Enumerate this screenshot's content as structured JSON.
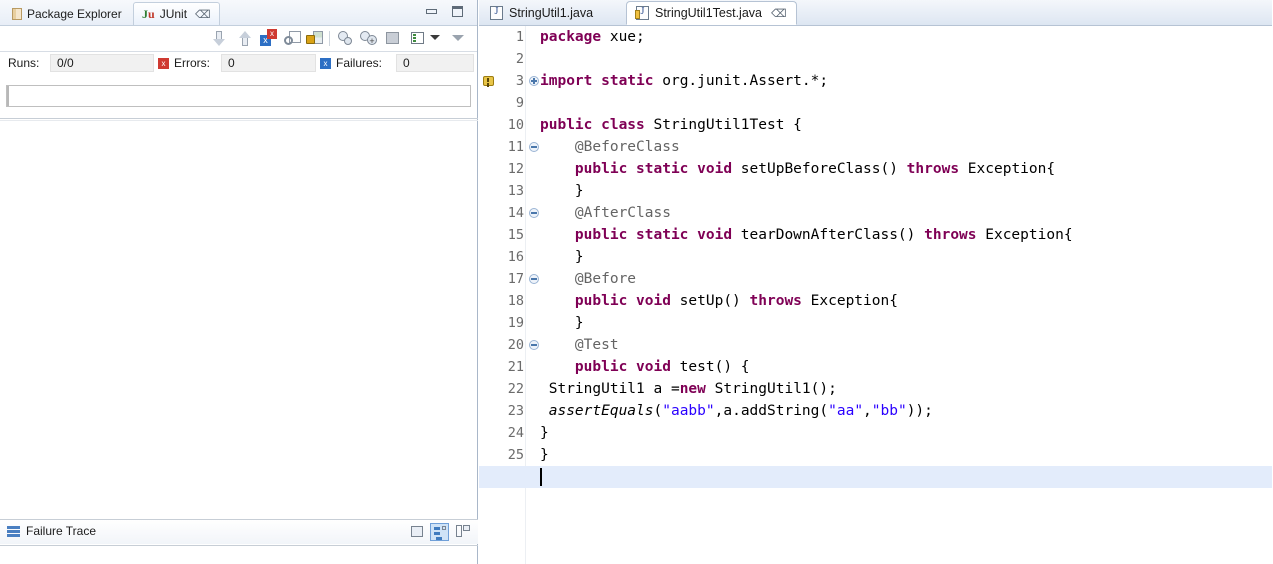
{
  "left_view": {
    "tabs": [
      {
        "label": "Package Explorer",
        "icon": "package-explorer-icon",
        "active": false,
        "closable": false
      },
      {
        "label": "JUnit",
        "icon": "junit-icon",
        "active": true,
        "closable": true
      }
    ],
    "window_controls": [
      {
        "name": "minimize",
        "icon": "minimize-icon"
      },
      {
        "name": "maximize",
        "icon": "maximize-icon"
      }
    ],
    "toolbar": [
      {
        "name": "next-failure-button",
        "icon": "arrow-down-icon"
      },
      {
        "name": "previous-failure-button",
        "icon": "arrow-up-icon"
      },
      {
        "name": "show-failures-only-button",
        "icon": "failures-filter-icon"
      },
      {
        "name": "rerun-test-button",
        "icon": "rerun-icon"
      },
      {
        "name": "scroll-lock-button",
        "icon": "lock-icon"
      },
      {
        "name": "rerun-last-test-button",
        "icon": "history-icon"
      },
      {
        "name": "rerun-failed-tests-button",
        "icon": "history-add-icon"
      },
      {
        "name": "show-console-button",
        "icon": "console-icon"
      },
      {
        "name": "test-run-history-button",
        "icon": "test-list-icon"
      },
      {
        "name": "test-run-history-dropdown",
        "icon": "chevron-down-icon"
      },
      {
        "name": "view-menu-button",
        "icon": "view-menu-icon"
      }
    ],
    "counters": {
      "runs_label": "Runs:",
      "runs_value": "0/0",
      "errors_label": "Errors:",
      "errors_value": "0",
      "failures_label": "Failures:",
      "failures_value": "0"
    },
    "progress": {
      "percent": 0
    },
    "failure_trace": {
      "label": "Failure Trace",
      "toolbar": [
        {
          "name": "copy-trace-button",
          "icon": "copy-trace-icon",
          "selected": false
        },
        {
          "name": "filter-stack-trace-button",
          "icon": "filter-stack-icon",
          "selected": true
        },
        {
          "name": "compare-result-button",
          "icon": "compare-layout-icon",
          "selected": false
        }
      ]
    }
  },
  "editor": {
    "tabs": [
      {
        "label": "StringUtil1.java",
        "active": false,
        "dirty": false,
        "closable": false
      },
      {
        "label": "StringUtil1Test.java",
        "active": true,
        "dirty": true,
        "closable": true
      }
    ],
    "current_line": 26,
    "lines": [
      {
        "num": "1",
        "fold": "none",
        "annot": "none",
        "tokens": [
          {
            "t": "package",
            "c": "kw"
          },
          {
            "t": " xue;",
            "c": "plain"
          }
        ]
      },
      {
        "num": "2",
        "fold": "none",
        "annot": "none",
        "tokens": [
          {
            "t": "",
            "c": "plain"
          }
        ]
      },
      {
        "num": "3",
        "fold": "plus",
        "annot": "warning",
        "tokens": [
          {
            "t": "import static",
            "c": "kw"
          },
          {
            "t": " org.junit.Assert.*;",
            "c": "plain"
          }
        ]
      },
      {
        "num": "9",
        "fold": "none",
        "annot": "none",
        "tokens": [
          {
            "t": "",
            "c": "plain"
          }
        ]
      },
      {
        "num": "10",
        "fold": "none",
        "annot": "none",
        "tokens": [
          {
            "t": "public class",
            "c": "kw"
          },
          {
            "t": " StringUtil1Test {",
            "c": "plain"
          }
        ]
      },
      {
        "num": "11",
        "fold": "minus",
        "annot": "none",
        "tokens": [
          {
            "t": "    @BeforeClass",
            "c": "annot"
          }
        ]
      },
      {
        "num": "12",
        "fold": "none",
        "annot": "none",
        "tokens": [
          {
            "t": "    ",
            "c": "plain"
          },
          {
            "t": "public static void",
            "c": "kw"
          },
          {
            "t": " setUpBeforeClass() ",
            "c": "plain"
          },
          {
            "t": "throws",
            "c": "kw"
          },
          {
            "t": " Exception{",
            "c": "plain"
          }
        ]
      },
      {
        "num": "13",
        "fold": "none",
        "annot": "none",
        "tokens": [
          {
            "t": "    }",
            "c": "plain"
          }
        ]
      },
      {
        "num": "14",
        "fold": "minus",
        "annot": "none",
        "tokens": [
          {
            "t": "    @AfterClass",
            "c": "annot"
          }
        ]
      },
      {
        "num": "15",
        "fold": "none",
        "annot": "none",
        "tokens": [
          {
            "t": "    ",
            "c": "plain"
          },
          {
            "t": "public static void",
            "c": "kw"
          },
          {
            "t": " tearDownAfterClass() ",
            "c": "plain"
          },
          {
            "t": "throws",
            "c": "kw"
          },
          {
            "t": " Exception{",
            "c": "plain"
          }
        ]
      },
      {
        "num": "16",
        "fold": "none",
        "annot": "none",
        "tokens": [
          {
            "t": "    }",
            "c": "plain"
          }
        ]
      },
      {
        "num": "17",
        "fold": "minus",
        "annot": "none",
        "tokens": [
          {
            "t": "    @Before",
            "c": "annot"
          }
        ]
      },
      {
        "num": "18",
        "fold": "none",
        "annot": "none",
        "tokens": [
          {
            "t": "    ",
            "c": "plain"
          },
          {
            "t": "public void",
            "c": "kw"
          },
          {
            "t": " setUp() ",
            "c": "plain"
          },
          {
            "t": "throws",
            "c": "kw"
          },
          {
            "t": " Exception{",
            "c": "plain"
          }
        ]
      },
      {
        "num": "19",
        "fold": "none",
        "annot": "none",
        "tokens": [
          {
            "t": "    }",
            "c": "plain"
          }
        ]
      },
      {
        "num": "20",
        "fold": "minus",
        "annot": "none",
        "tokens": [
          {
            "t": "    @Test",
            "c": "annot"
          }
        ]
      },
      {
        "num": "21",
        "fold": "none",
        "annot": "none",
        "tokens": [
          {
            "t": "    ",
            "c": "plain"
          },
          {
            "t": "public void",
            "c": "kw"
          },
          {
            "t": " test() {",
            "c": "plain"
          }
        ]
      },
      {
        "num": "22",
        "fold": "none",
        "annot": "none",
        "tokens": [
          {
            "t": " StringUtil1 a =",
            "c": "plain"
          },
          {
            "t": "new",
            "c": "kw"
          },
          {
            "t": " StringUtil1();",
            "c": "plain"
          }
        ]
      },
      {
        "num": "23",
        "fold": "none",
        "annot": "none",
        "tokens": [
          {
            "t": " ",
            "c": "plain"
          },
          {
            "t": "assertEquals",
            "c": "stat"
          },
          {
            "t": "(",
            "c": "plain"
          },
          {
            "t": "\"aabb\"",
            "c": "str"
          },
          {
            "t": ",a.addString(",
            "c": "plain"
          },
          {
            "t": "\"aa\"",
            "c": "str"
          },
          {
            "t": ",",
            "c": "plain"
          },
          {
            "t": "\"bb\"",
            "c": "str"
          },
          {
            "t": "));",
            "c": "plain"
          }
        ]
      },
      {
        "num": "24",
        "fold": "none",
        "annot": "none",
        "tokens": [
          {
            "t": "}",
            "c": "plain"
          }
        ]
      },
      {
        "num": "25",
        "fold": "none",
        "annot": "none",
        "tokens": [
          {
            "t": "}",
            "c": "plain"
          }
        ]
      },
      {
        "num": "26",
        "fold": "none",
        "annot": "none",
        "tokens": [
          {
            "t": "",
            "c": "plain"
          }
        ]
      }
    ]
  },
  "colors": {
    "keyword": "#7f0055",
    "string": "#2a00ff",
    "annotation": "#646464",
    "current_line_highlight": "#e3ecfb",
    "selected_toolbar": "#cfe3f7"
  }
}
